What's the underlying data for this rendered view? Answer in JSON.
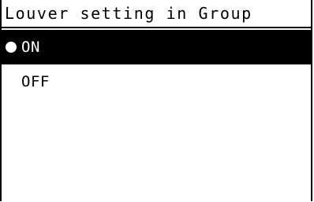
{
  "title": "Louver setting in Group",
  "colors": {
    "background": "#ffffff",
    "foreground": "#000000",
    "selected_background": "#000000",
    "selected_foreground": "#ffffff"
  },
  "options": [
    {
      "label": "ON",
      "selected": true,
      "marker_icon": "filled-circle-icon"
    },
    {
      "label": "OFF",
      "selected": false
    }
  ]
}
